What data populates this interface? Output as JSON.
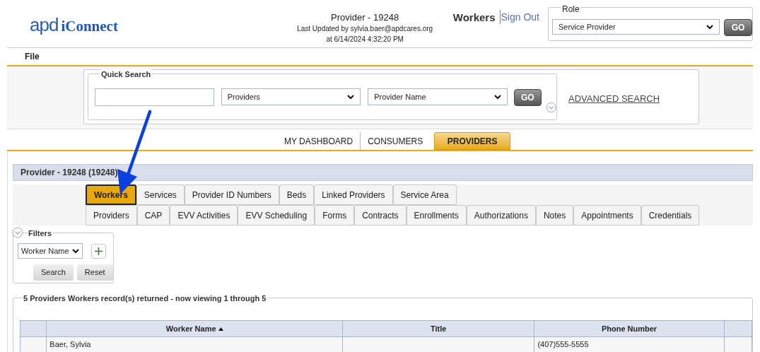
{
  "logo": {
    "mark": "apd",
    "name": "iConnect"
  },
  "header": {
    "title": "Provider - 19248",
    "updated_by": "Last Updated by sylvia.baer@apdcares.org",
    "updated_at": "at 6/14/2024 4:32:20 PM",
    "page": "Workers",
    "sign_out": "Sign Out"
  },
  "role": {
    "legend": "Role",
    "value": "Service Provider",
    "button": "GO"
  },
  "menu": [
    "File"
  ],
  "quick_search": {
    "legend": "Quick Search",
    "type": "Providers",
    "field": "Provider Name",
    "button": "GO",
    "advanced": "ADVANCED SEARCH"
  },
  "nav_tabs": [
    {
      "label": "MY DASHBOARD",
      "selected": false
    },
    {
      "label": "CONSUMERS",
      "selected": false
    },
    {
      "label": "PROVIDERS",
      "selected": true
    }
  ],
  "panel_title": "Provider - 19248 (19248)",
  "tabs_row_1": [
    {
      "label": "Workers",
      "selected": true
    },
    {
      "label": "Services",
      "selected": false
    },
    {
      "label": "Provider ID Numbers",
      "selected": false
    },
    {
      "label": "Beds",
      "selected": false
    },
    {
      "label": "Linked Providers",
      "selected": false
    },
    {
      "label": "Service Area",
      "selected": false
    }
  ],
  "tabs_row_2": [
    {
      "label": "Providers",
      "selected": false
    },
    {
      "label": "CAP",
      "selected": false
    },
    {
      "label": "EVV Activities",
      "selected": false
    },
    {
      "label": "EVV Scheduling",
      "selected": false
    },
    {
      "label": "Forms",
      "selected": false
    },
    {
      "label": "Contracts",
      "selected": false
    },
    {
      "label": "Enrollments",
      "selected": false
    },
    {
      "label": "Authorizations",
      "selected": false
    },
    {
      "label": "Notes",
      "selected": false
    },
    {
      "label": "Appointments",
      "selected": false
    },
    {
      "label": "Credentials",
      "selected": false
    }
  ],
  "filters": {
    "legend": "Filters",
    "field": "Worker Name",
    "buttons": [
      "Search",
      "Reset"
    ]
  },
  "results": {
    "legend": "5 Providers Workers record(s) returned - now viewing 1 through 5",
    "columns": [
      {
        "label": "Worker Name",
        "sorted": true
      },
      {
        "label": "Title",
        "sorted": false
      },
      {
        "label": "Phone Number",
        "sorted": false
      }
    ],
    "rows": [
      {
        "worker_name": "Baer, Sylvia",
        "phone_number": "(407)555-5555"
      }
    ]
  }
}
